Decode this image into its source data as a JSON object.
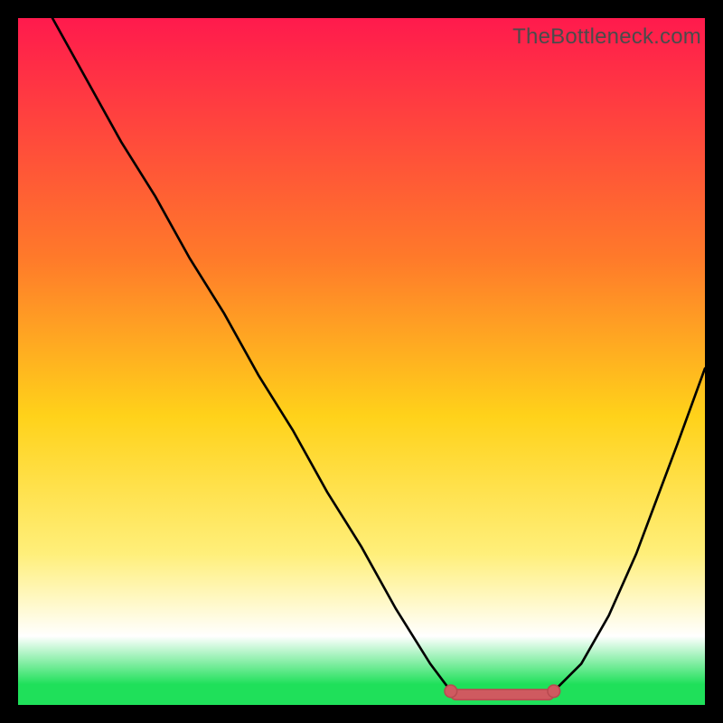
{
  "watermark_text": "TheBottleneck.com",
  "colors": {
    "top": "#ff1a4d",
    "mid_upper": "#ff7a2a",
    "mid": "#ffd21a",
    "mid_lower": "#ffef7a",
    "white": "#ffffff",
    "green": "#1fe05a",
    "curve": "#000000",
    "marker_fill": "#cf5a60",
    "marker_stroke": "#b84a50"
  },
  "chart_data": {
    "type": "line",
    "title": "",
    "xlabel": "",
    "ylabel": "",
    "xlim": [
      0,
      100
    ],
    "ylim": [
      0,
      100
    ],
    "grid": false,
    "legend": false,
    "series": [
      {
        "name": "bottleneck-curve",
        "x": [
          5,
          10,
          15,
          20,
          25,
          30,
          35,
          40,
          45,
          50,
          55,
          60,
          63,
          66,
          70,
          74,
          78,
          82,
          86,
          90,
          93,
          96,
          100
        ],
        "y": [
          100,
          91,
          82,
          74,
          65,
          57,
          48,
          40,
          31,
          23,
          14,
          6,
          2,
          1,
          1,
          1,
          2,
          6,
          13,
          22,
          30,
          38,
          49
        ]
      }
    ],
    "markers": [
      {
        "name": "optimal-range-left",
        "x": 63,
        "y": 2
      },
      {
        "name": "optimal-range-right",
        "x": 78,
        "y": 2
      }
    ],
    "optimal_bar": {
      "x_start": 63,
      "x_end": 78,
      "y": 1.5
    },
    "gradient_stops": [
      {
        "pct": 0,
        "key": "top"
      },
      {
        "pct": 35,
        "key": "mid_upper"
      },
      {
        "pct": 58,
        "key": "mid"
      },
      {
        "pct": 78,
        "key": "mid_lower"
      },
      {
        "pct": 90,
        "key": "white"
      },
      {
        "pct": 97,
        "key": "green"
      },
      {
        "pct": 100,
        "key": "green"
      }
    ]
  }
}
